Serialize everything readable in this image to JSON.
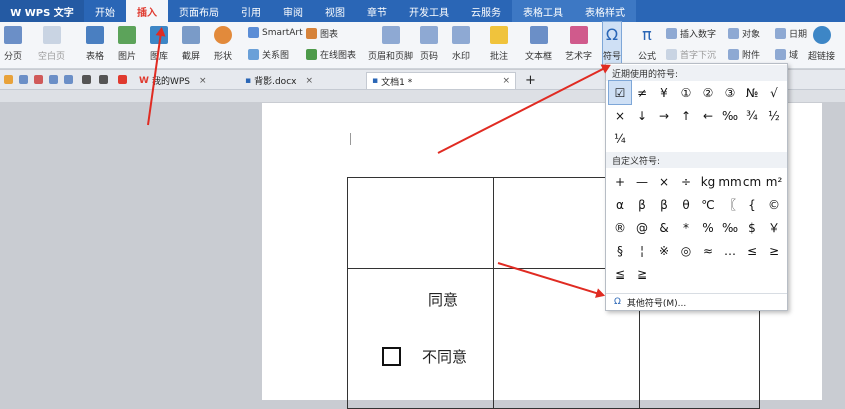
{
  "menubar": {
    "app_title": "W WPS 文字",
    "tabs": [
      {
        "label": "开始"
      },
      {
        "label": "插入"
      },
      {
        "label": "页面布局"
      },
      {
        "label": "引用"
      },
      {
        "label": "审阅"
      },
      {
        "label": "视图"
      },
      {
        "label": "章节"
      },
      {
        "label": "开发工具"
      },
      {
        "label": "云服务"
      },
      {
        "label": "表格工具"
      },
      {
        "label": "表格样式"
      }
    ]
  },
  "ribbon": {
    "page_break": "分页",
    "blank_page": "空白页",
    "table": "表格",
    "picture": "图片",
    "gallery": "图库",
    "screenshot": "截屏",
    "shapes": "形状",
    "smartart": "SmartArt",
    "chart": "图表",
    "relation_chart": "关系图",
    "online_chart": "在线图表",
    "header_footer": "页眉和页脚",
    "page_number": "页码",
    "watermark": "水印",
    "comment": "批注",
    "text_box": "文本框",
    "art_text": "艺术字",
    "symbol": "符号",
    "formula": "公式",
    "insert_number": "插入数字",
    "object": "对象",
    "date": "日期",
    "drop_cap": "首字下沉",
    "attachment": "附件",
    "field": "域",
    "hyperlink": "超链接"
  },
  "doc_tabs": [
    {
      "label": "我的WPS",
      "close": "×"
    },
    {
      "label": "背影.docx",
      "close": "×"
    },
    {
      "label": "文档1 *",
      "close": "×"
    }
  ],
  "new_tab": "+",
  "document": {
    "agree": "同意",
    "checkbox": "☐",
    "disagree": "不同意"
  },
  "symbol_menu": {
    "recent_header": "近期使用的符号:",
    "recent": [
      "☑",
      "≠",
      "¥",
      "①",
      "②",
      "③",
      "№",
      "√",
      "×",
      "↓",
      "→",
      "↑",
      "←",
      "‰",
      "¾",
      "½",
      "¼"
    ],
    "custom_header": "自定义符号:",
    "custom": [
      "+",
      "—",
      "×",
      "÷",
      "kg",
      "mm",
      "cm",
      "m²",
      "α",
      "β",
      "β",
      "θ",
      "℃",
      "〖",
      "{",
      "©",
      "®",
      "@",
      "&",
      "*",
      "%",
      "‰",
      "$",
      "￥",
      "§",
      "¦",
      "※",
      "◎",
      "≈",
      "…",
      "≤",
      "≥",
      "≦",
      "≧"
    ],
    "more": "其他符号(M)...",
    "more_icon": "omega-icon"
  },
  "colors": {
    "accent": "#2a66b6",
    "active_tab_text": "#e03a2f",
    "arrow": "#e02b22"
  }
}
